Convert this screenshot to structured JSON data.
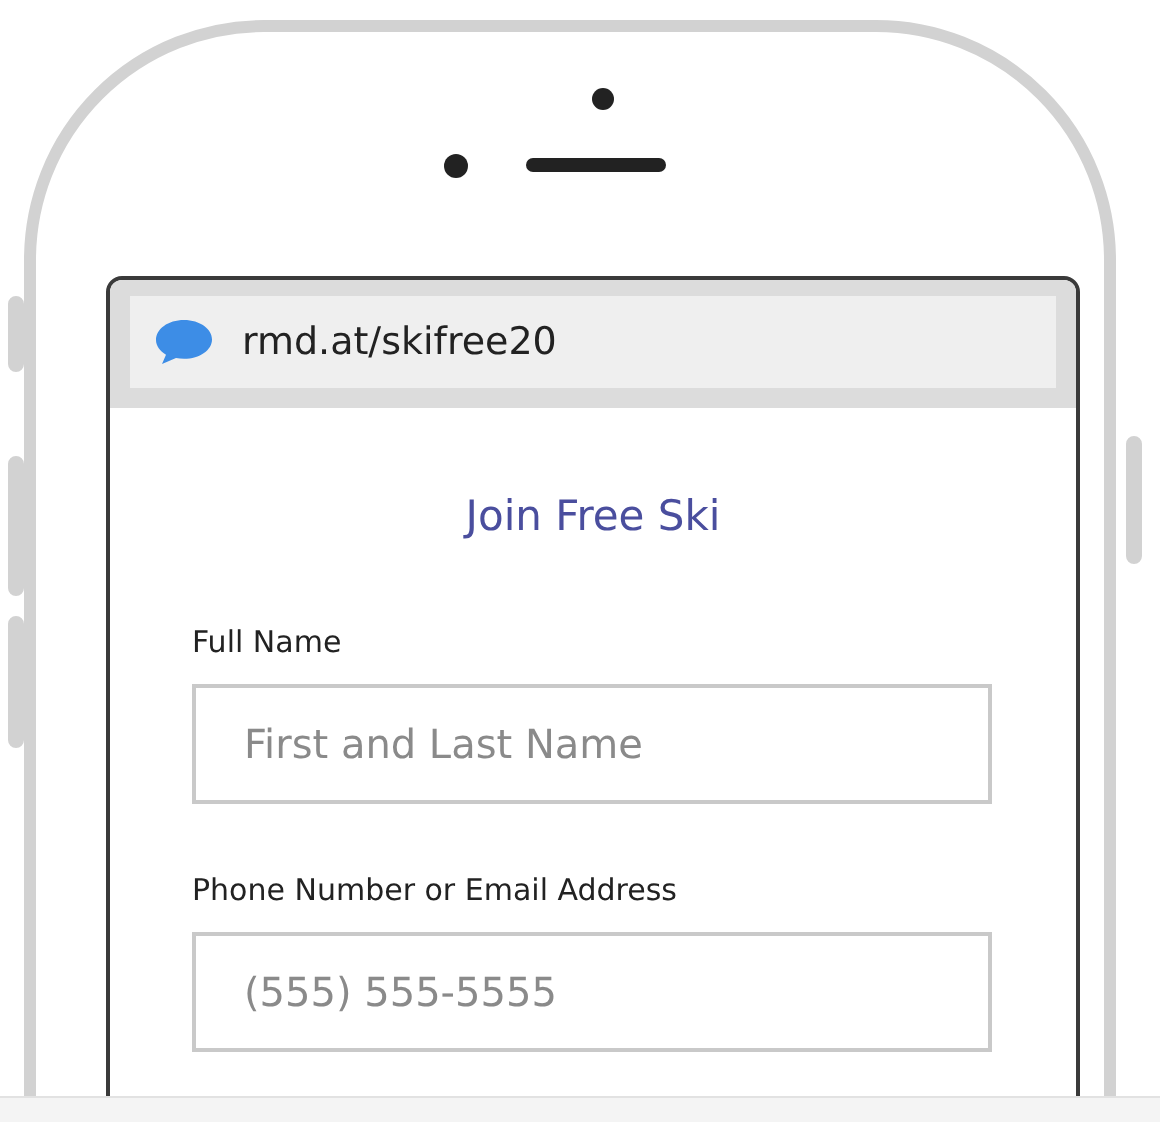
{
  "address_bar": {
    "url": "rmd.at/skifree20"
  },
  "form": {
    "title": "Join Free Ski",
    "fields": [
      {
        "label": "Full Name",
        "placeholder": "First and Last Name"
      },
      {
        "label": "Phone Number or Email Address",
        "placeholder": "(555) 555-5555"
      }
    ]
  }
}
